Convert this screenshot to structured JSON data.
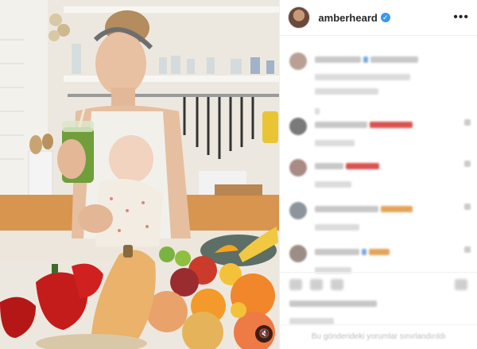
{
  "post": {
    "username": "amberheard",
    "verified_glyph": "✓",
    "more_glyph": "•••",
    "mute_glyph": "🔇",
    "comments_closed_text": "Bu gönderideki yorumlar sınırlandırıldı"
  },
  "icons": [
    "heart-icon",
    "comment-icon",
    "share-icon",
    "bookmark-icon",
    "mute-icon",
    "more-icon",
    "verified-icon"
  ],
  "colors": {
    "verified": "#3897f0",
    "blur_red": "#d9534f",
    "blur_orange": "#e3a45a",
    "blur_blue": "#7aa9e0"
  }
}
